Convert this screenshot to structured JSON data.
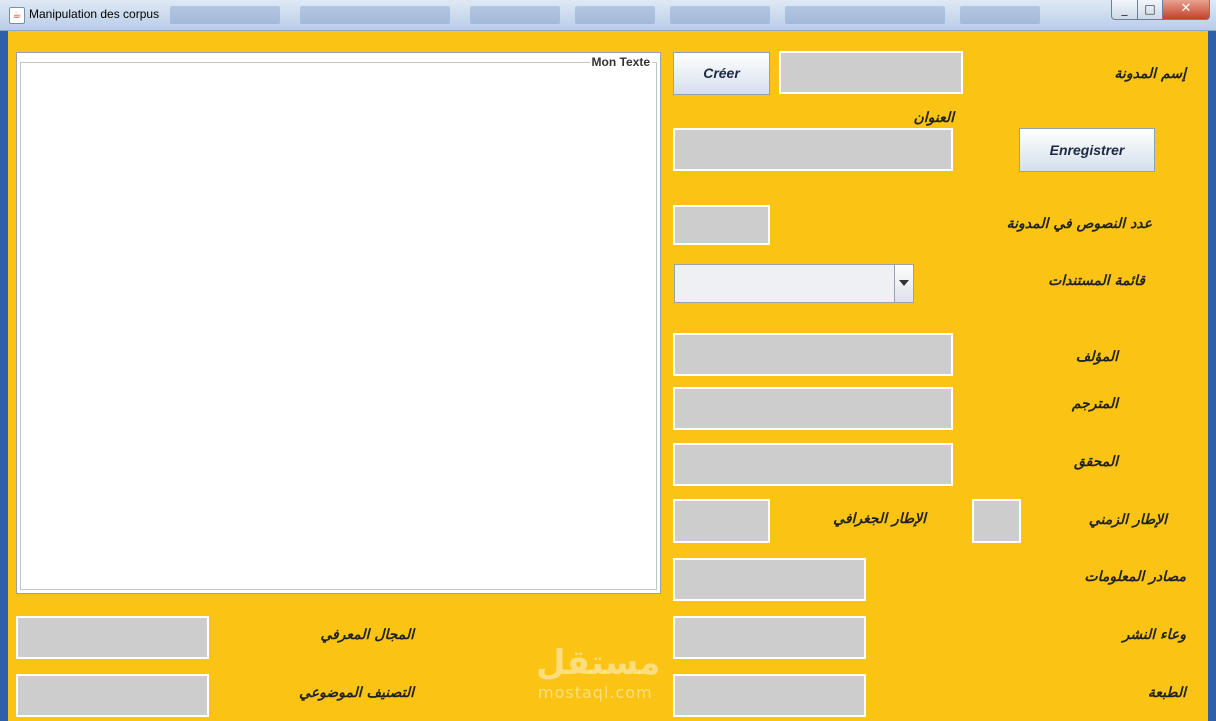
{
  "window": {
    "title": "Manipulation des corpus",
    "app_icon": "java-icon",
    "minimize_symbol": "_",
    "maximize_symbol": "□",
    "close_symbol": "✕"
  },
  "text_panel": {
    "title": "Mon Texte"
  },
  "buttons": {
    "create": "Créer",
    "save": "Enregistrer"
  },
  "labels": {
    "corpus_name": "إسم المدونة",
    "title": "العنوان",
    "text_count": "عدد النصوص في المدونة",
    "documents_list": "قائمة المستندات",
    "author": "المؤلف",
    "translator": "المترجم",
    "editor": "المحقق",
    "time_frame": "الإطار الزمني",
    "geo_frame": "الإطار الجغرافي",
    "info_sources": "مصادر المعلومات",
    "publication_medium": "وعاء النشر",
    "edition": "الطبعة",
    "knowledge_domain": "المجال المعرفي",
    "subject_classification": "التصنيف الموضوعي"
  },
  "fields": {
    "corpus_name": "",
    "title": "",
    "text_count": "",
    "documents_list": "",
    "author": "",
    "translator": "",
    "editor": "",
    "time_frame": "",
    "geo_frame": "",
    "info_sources": "",
    "publication_medium": "",
    "edition": "",
    "knowledge_domain": "",
    "subject_classification": ""
  },
  "watermark": {
    "text": "مستقل",
    "sub": "mostaql.com"
  },
  "colors": {
    "background": "#fbc414",
    "field": "#cdcdcd"
  }
}
